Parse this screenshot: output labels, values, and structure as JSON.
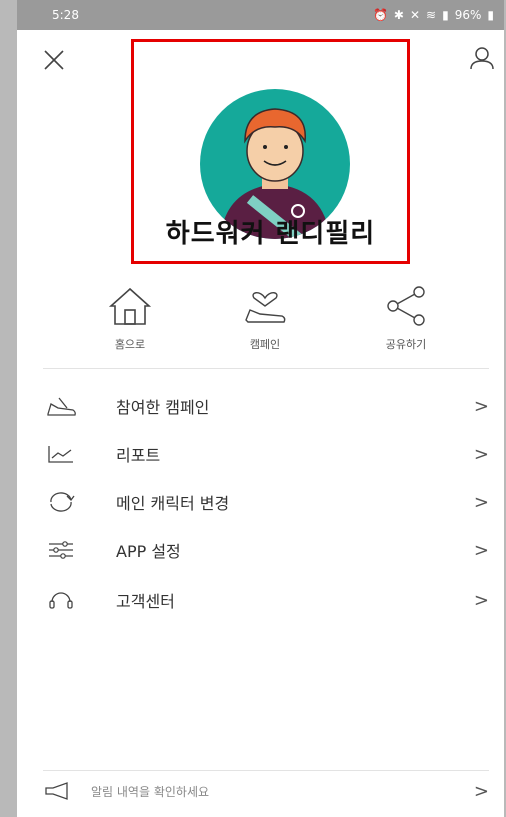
{
  "status_bar": {
    "time": "5:28",
    "battery_text": "96%",
    "icons": [
      "alarm-icon",
      "bluetooth-icon",
      "mute-icon",
      "wifi-icon",
      "signal-icon",
      "battery-icon"
    ]
  },
  "header": {
    "close_icon": "close-icon",
    "user_icon": "user-icon"
  },
  "profile": {
    "name": "하드워커 랜디필리",
    "highlight_color": "#e50000",
    "avatar_bg": "#15a99a"
  },
  "quick_actions": [
    {
      "label": "홈으로",
      "icon": "home-icon"
    },
    {
      "label": "캠페인",
      "icon": "sneaker-heart-icon"
    },
    {
      "label": "공유하기",
      "icon": "share-icon"
    }
  ],
  "menu": [
    {
      "label": "참여한 캠페인",
      "icon": "sneaker-icon",
      "chevron": ">"
    },
    {
      "label": "리포트",
      "icon": "chart-line-icon",
      "chevron": ">"
    },
    {
      "label": "메인 캐릭터 변경",
      "icon": "refresh-icon",
      "chevron": ">"
    },
    {
      "label": "APP 설정",
      "icon": "sliders-icon",
      "chevron": ">"
    },
    {
      "label": "고객센터",
      "icon": "headset-icon",
      "chevron": ">"
    }
  ],
  "notice": {
    "label": "알림 내역을 확인하세요",
    "icon": "megaphone-icon",
    "chevron": ">"
  }
}
